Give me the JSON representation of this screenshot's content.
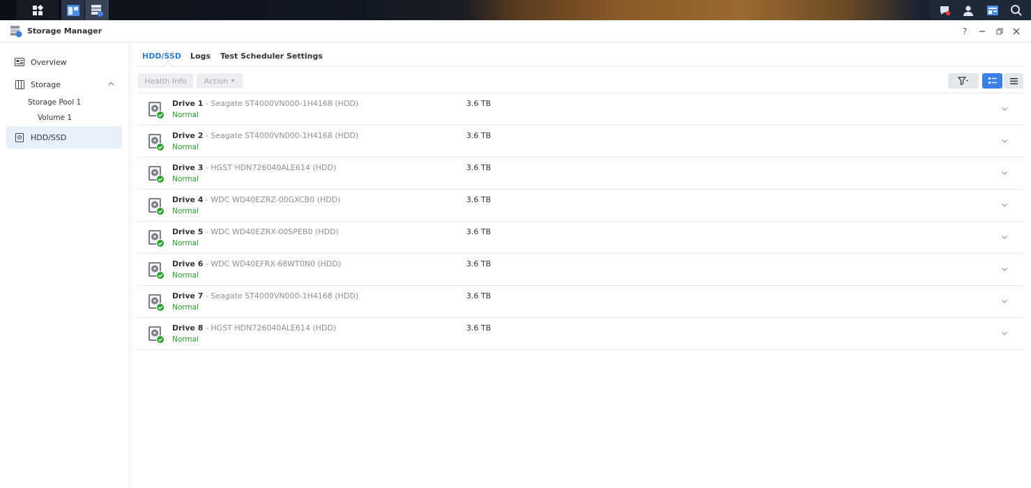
{
  "window": {
    "title": "Storage Manager"
  },
  "window_controls": {
    "help": "?"
  },
  "sidebar": {
    "overview": "Overview",
    "storage": "Storage",
    "storage_pool": "Storage Pool 1",
    "volume": "Volume 1",
    "hdd_ssd": "HDD/SSD"
  },
  "tabs": [
    "HDD/SSD",
    "Logs",
    "Test Scheduler",
    "Settings"
  ],
  "toolbar": {
    "health_info": "Health Info",
    "action": "Action"
  },
  "drives": [
    {
      "name": "Drive 1",
      "model": "Seagate ST4000VN000-1H4168 (HDD)",
      "status": "Normal",
      "size": "3.6 TB"
    },
    {
      "name": "Drive 2",
      "model": "Seagate ST4000VN000-1H4168 (HDD)",
      "status": "Normal",
      "size": "3.6 TB"
    },
    {
      "name": "Drive 3",
      "model": "HGST HDN726040ALE614 (HDD)",
      "status": "Normal",
      "size": "3.6 TB"
    },
    {
      "name": "Drive 4",
      "model": "WDC WD40EZRZ-00GXCB0 (HDD)",
      "status": "Normal",
      "size": "3.6 TB"
    },
    {
      "name": "Drive 5",
      "model": "WDC WD40EZRX-00SPEB0 (HDD)",
      "status": "Normal",
      "size": "3.6 TB"
    },
    {
      "name": "Drive 6",
      "model": "WDC WD40EFRX-68WT0N0 (HDD)",
      "status": "Normal",
      "size": "3.6 TB"
    },
    {
      "name": "Drive 7",
      "model": "Seagate ST4000VN000-1H4168 (HDD)",
      "status": "Normal",
      "size": "3.6 TB"
    },
    {
      "name": "Drive 8",
      "model": "HGST HDN726040ALE614 (HDD)",
      "status": "Normal",
      "size": "3.6 TB"
    }
  ],
  "colors": {
    "accent": "#2f7fd0",
    "status_ok": "#2aa12a",
    "active_nav": "#e7effa"
  },
  "icons": [
    "grid-icon",
    "storage-manager-icon",
    "notifications-icon",
    "user-icon",
    "widgets-icon",
    "search-icon",
    "overview-icon",
    "storage-icon",
    "hdd-icon",
    "filter-icon",
    "detail-view-icon",
    "list-view-icon",
    "chevron-down-icon"
  ]
}
